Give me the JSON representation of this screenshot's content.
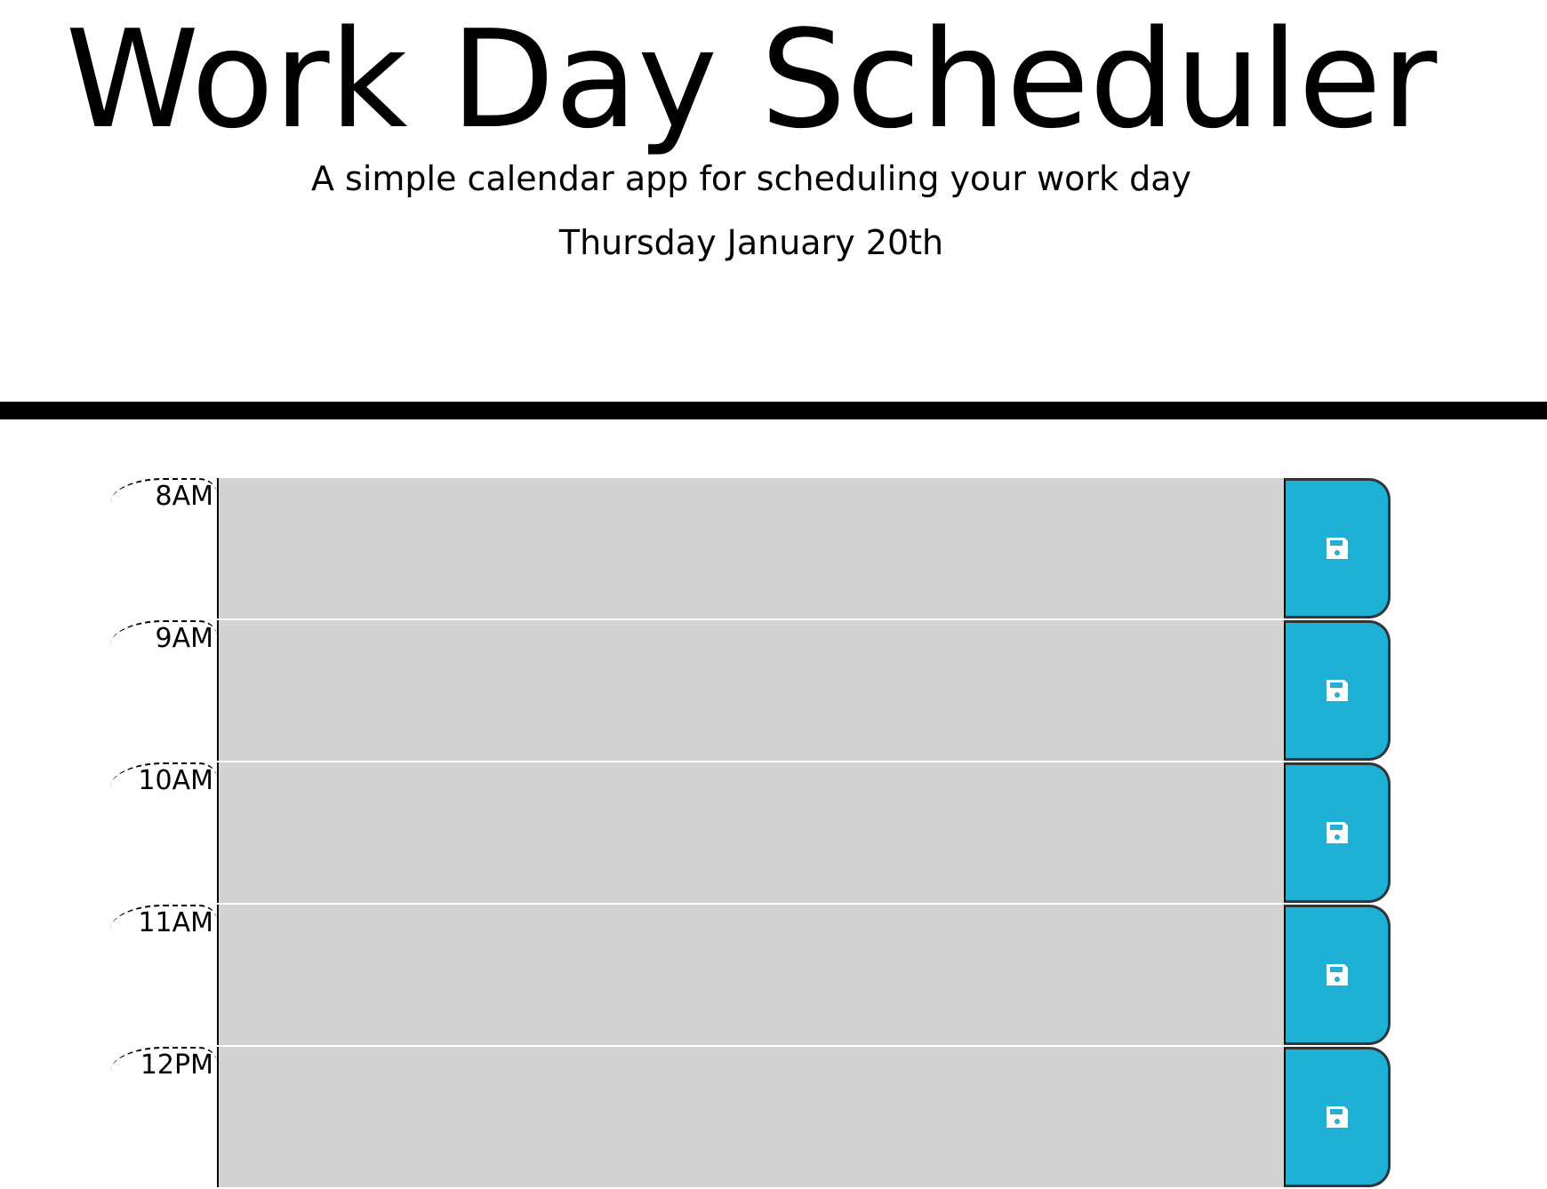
{
  "header": {
    "title": "Work Day Scheduler",
    "subtitle": "A simple calendar app for scheduling your work day",
    "current_day": "Thursday January 20th"
  },
  "colors": {
    "past": "#d3d3d3",
    "save_button": "#1fb1d5"
  },
  "time_blocks": [
    {
      "hour": "8AM",
      "description": "",
      "save_icon": "floppy-disk-icon"
    },
    {
      "hour": "9AM",
      "description": "",
      "save_icon": "floppy-disk-icon"
    },
    {
      "hour": "10AM",
      "description": "",
      "save_icon": "floppy-disk-icon"
    },
    {
      "hour": "11AM",
      "description": "",
      "save_icon": "floppy-disk-icon"
    },
    {
      "hour": "12PM",
      "description": "",
      "save_icon": "floppy-disk-icon"
    }
  ]
}
